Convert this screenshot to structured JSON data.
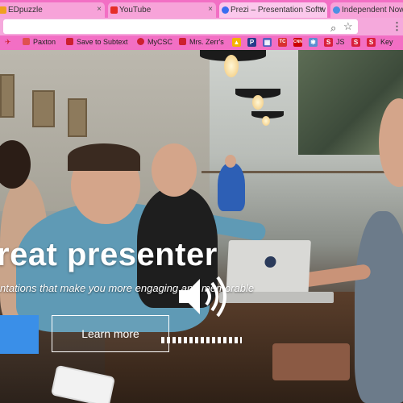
{
  "browser": {
    "tabs": [
      {
        "title": "EDpuzzle",
        "active": false,
        "favicon_color": "#f0a020"
      },
      {
        "title": "YouTube",
        "active": false,
        "favicon_color": "#e52d27"
      },
      {
        "title": "Prezi – Presentation Softw",
        "active": true,
        "favicon_color": "#3a6df0"
      },
      {
        "title": "Independent Now",
        "active": false,
        "favicon_color": "#4b90e2"
      }
    ],
    "close_glyph": "×",
    "url_icons": {
      "zoom": "search-icon",
      "star": "star-icon",
      "menu": "menu-icon"
    },
    "zoom_glyph": "⌕",
    "star_glyph": "☆",
    "menu_glyph": "⋮",
    "bookmarks": [
      {
        "label": "Paxton",
        "icon": "bookmark-icon",
        "icon_color": "#e05050"
      },
      {
        "label": "Save to Subtext",
        "icon": "subtext-icon",
        "icon_color": "#cc2030"
      },
      {
        "label": "MyCSC",
        "icon": "globe-icon",
        "icon_color": "#cc2030"
      },
      {
        "label": "Mrs. Zerr's",
        "icon": "bookmark-icon",
        "icon_color": "#cc2030"
      },
      {
        "label": "JS",
        "icon": "s-icon",
        "icon_color": "#d81f3b"
      },
      {
        "label": "Key",
        "icon": "s-icon",
        "icon_color": "#d81f3b"
      }
    ],
    "bookmark_icons": [
      {
        "name": "drive-icon",
        "color": "#f4b400",
        "glyph": "▲"
      },
      {
        "name": "p-icon",
        "color": "#273b8a",
        "glyph": "P"
      },
      {
        "name": "grid-icon",
        "color": "#5560c0",
        "glyph": "▦"
      },
      {
        "name": "tab-icon",
        "color": "#d93030",
        "glyph": "TC"
      },
      {
        "name": "cnn-icon",
        "color": "#cc0000",
        "glyph": "CNN"
      },
      {
        "name": "slack-icon",
        "color": "#5b8fd0",
        "glyph": "✱"
      },
      {
        "name": "s-icon",
        "color": "#d81f3b",
        "glyph": "S"
      }
    ]
  },
  "hero": {
    "headline": "reat presenter",
    "subline": "ntations that make you more engaging and memorable",
    "secondary_button": "Learn more",
    "colors": {
      "primary_button": "#3a8fe8",
      "text": "#ffffff"
    },
    "audio_icon": "speaker-icon",
    "audio_progress": 0.85
  }
}
